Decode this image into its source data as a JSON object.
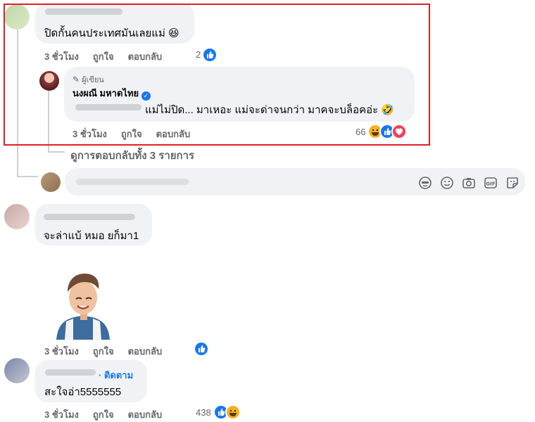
{
  "comment1": {
    "text": "ปิดกั้นคนประเทศมันเลยแม่ 😆",
    "time": "3 ชั่วโมง",
    "like": "ถูกใจ",
    "reply": "ตอบกลับ",
    "reaction_count": "2",
    "reactions": [
      "like"
    ]
  },
  "reply1": {
    "author_badge": "ผู้เขียน",
    "author_name": "นงผณี มหาดไทย",
    "verified": true,
    "text": "แม่ไม่ปิด... มาเหอะ แม่จะด่าจนกว่า มาคจะบล็อคอ่ะ 🤣",
    "time": "3 ชั่วโมง",
    "like": "ถูกใจ",
    "reply": "ตอบกลับ",
    "reaction_count": "66",
    "reactions": [
      "haha",
      "like",
      "love"
    ]
  },
  "view_replies": "ดูการตอบกลับทั้ง 3 รายการ",
  "composer": {
    "icons": [
      "avatar-sticker-icon",
      "emoji-icon",
      "camera-icon",
      "gif-icon",
      "sticker-icon"
    ]
  },
  "comment2": {
    "text": "จะล่าแบ้ หมอ ยก็มา1",
    "time": "3 ชั่วโมง",
    "like": "ถูกใจ",
    "reply": "ตอบกลับ",
    "reactions": [
      "like"
    ]
  },
  "comment3": {
    "follow": "· ติดตาม",
    "text": "สะใจอ่า5555555",
    "time": "3 ชั่วโมง",
    "like": "ถูกใจ",
    "reply": "ตอบกลับ",
    "reaction_count": "438",
    "reactions": [
      "like",
      "haha"
    ]
  },
  "colors": {
    "accent": "#1877f2",
    "highlight": "#e41e26",
    "bubble": "#f0f2f5",
    "muted": "#65676b"
  }
}
